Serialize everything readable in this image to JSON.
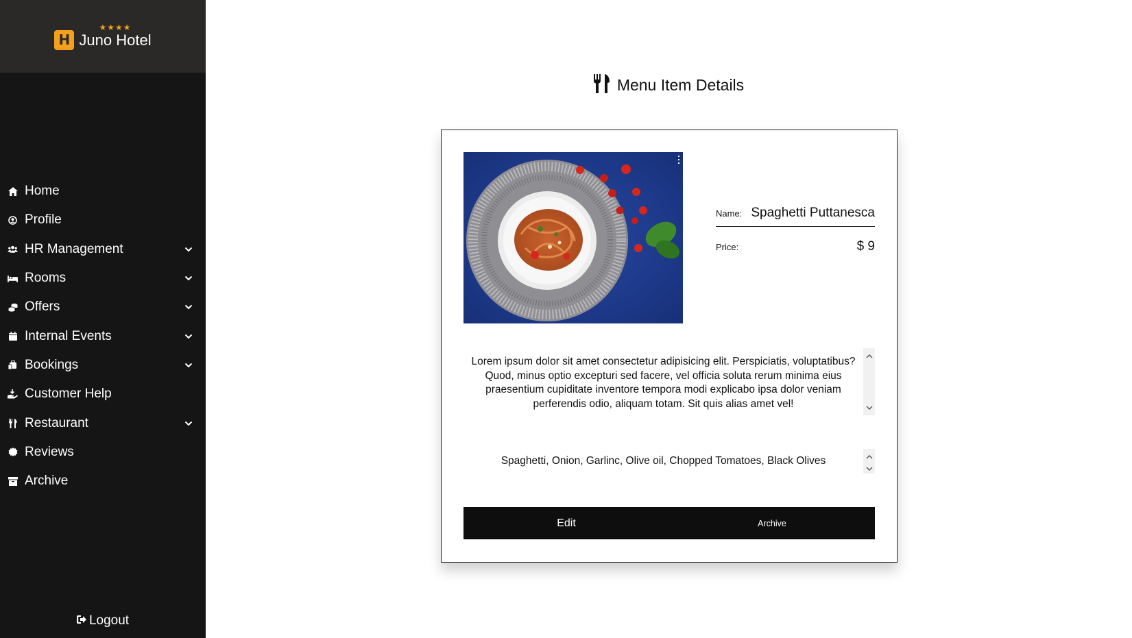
{
  "brand": {
    "name": "Juno Hotel",
    "logo_letter": "H",
    "stars": "★★★★",
    "accent": "#f4a01c"
  },
  "sidebar": {
    "items": [
      {
        "label": "Home",
        "icon": "home-icon",
        "chevron": false
      },
      {
        "label": "Profile",
        "icon": "user-circle-icon",
        "chevron": false
      },
      {
        "label": "HR Management",
        "icon": "users-icon",
        "chevron": true
      },
      {
        "label": "Rooms",
        "icon": "bed-icon",
        "chevron": true
      },
      {
        "label": "Offers",
        "icon": "coins-icon",
        "chevron": true
      },
      {
        "label": "Internal Events",
        "icon": "calendar-icon",
        "chevron": true
      },
      {
        "label": "Bookings",
        "icon": "luggage-icon",
        "chevron": true
      },
      {
        "label": "Customer Help",
        "icon": "hand-holding-icon",
        "chevron": false
      },
      {
        "label": "Restaurant",
        "icon": "utensils-icon",
        "chevron": true
      },
      {
        "label": "Reviews",
        "icon": "badge-icon",
        "chevron": false
      },
      {
        "label": "Archive",
        "icon": "archive-icon",
        "chevron": false
      }
    ],
    "logout_label": "Logout"
  },
  "page": {
    "title": "Menu Item Details",
    "title_icon": "utensils-icon"
  },
  "item": {
    "name_label": "Name:",
    "name": "Spaghetti Puttanesca",
    "price_label": "Price:",
    "price": "$ 9",
    "description": "Lorem ipsum dolor sit amet consectetur adipisicing elit. Perspiciatis, voluptatibus? Quod, minus optio excepturi sed facere, vel officia soluta rerum minima eius praesentium cupiditate inventore tempora modi explicabo ipsa dolor veniam perferendis odio, aliquam totam. Sit quis alias amet vel!",
    "ingredients": "Spaghetti, Onion, Garlinc, Olive oil, Chopped Tomatoes, Black Olives"
  },
  "actions": {
    "edit_label": "Edit",
    "archive_label": "Archive"
  },
  "colors": {
    "sidebar_bg": "#151515",
    "brand_bg": "#2a2928",
    "button_bg": "#0e0e0e",
    "photo_bg": "#1f3a8a"
  }
}
